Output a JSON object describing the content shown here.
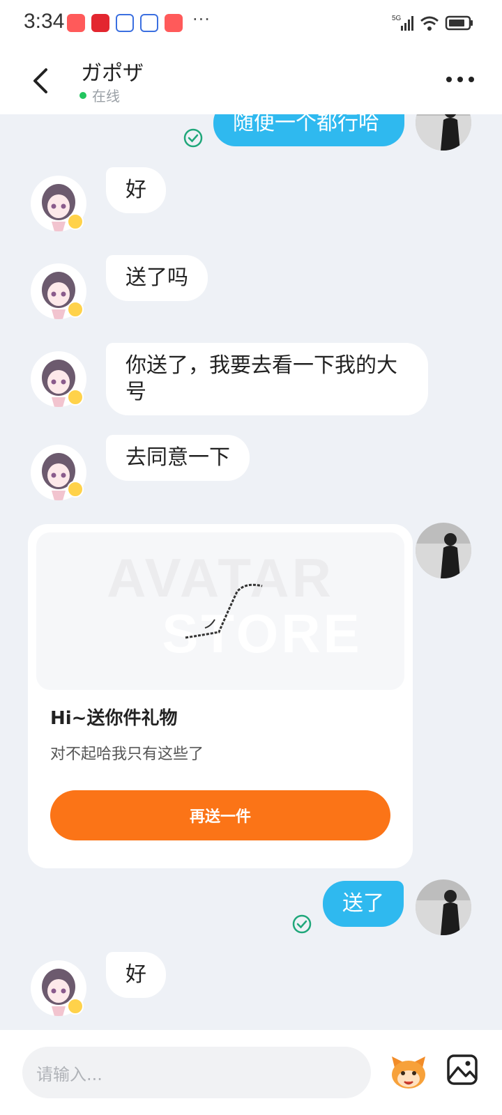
{
  "status_bar": {
    "time": "3:34",
    "more": "···",
    "network": "5G"
  },
  "header": {
    "title": "ガポザ",
    "status": "在线"
  },
  "messages": [
    {
      "side": "out",
      "text": "随便一个都行哈",
      "read": true
    },
    {
      "side": "in",
      "text": "好"
    },
    {
      "side": "in",
      "text": "送了吗"
    },
    {
      "side": "in",
      "text": "你送了，我要去看一下我的大号"
    },
    {
      "side": "in",
      "text": "去同意一下"
    },
    {
      "side": "out",
      "text": "送了",
      "read": true
    },
    {
      "side": "in",
      "text": "好"
    }
  ],
  "gift_card": {
    "watermark_line1": "AVATAR",
    "watermark_line2": "STORE",
    "title": "Hi~送你件礼物",
    "subtitle": "对不起哈我只有这些了",
    "button_label": "再送一件"
  },
  "input": {
    "placeholder": "请输入..."
  },
  "colors": {
    "outgoing_bubble": "#2fb9ef",
    "gift_button": "#fb7417",
    "online_dot": "#22c55e",
    "read_check": "#1fa77a"
  },
  "icons": [
    "back-arrow-icon",
    "more-icon",
    "read-check-icon",
    "emoji-mascot-icon",
    "image-icon"
  ]
}
